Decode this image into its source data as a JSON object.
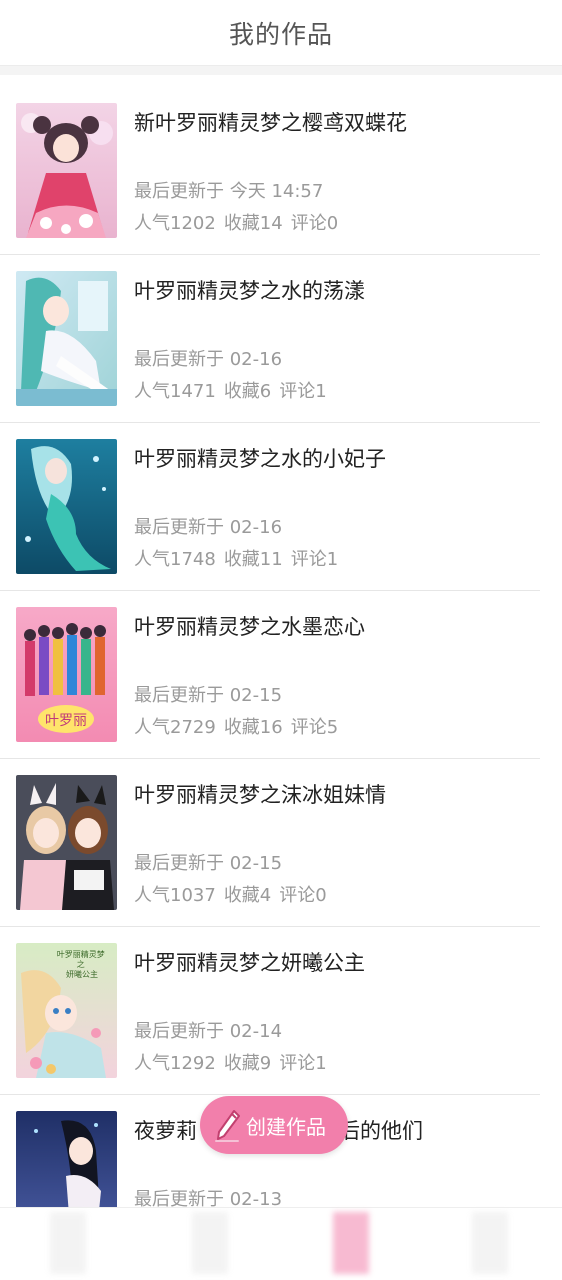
{
  "header": {
    "title": "我的作品"
  },
  "works": [
    {
      "title": "新叶罗丽精灵梦之樱鸢双蝶花",
      "updated": "最后更新于 今天 14:57",
      "popularity": "人气1202",
      "favorites": "收藏14",
      "comments": "评论0"
    },
    {
      "title": "叶罗丽精灵梦之水的荡漾",
      "updated": "最后更新于 02-16",
      "popularity": "人气1471",
      "favorites": "收藏6",
      "comments": "评论1"
    },
    {
      "title": "叶罗丽精灵梦之水的小妃子",
      "updated": "最后更新于 02-16",
      "popularity": "人气1748",
      "favorites": "收藏11",
      "comments": "评论1"
    },
    {
      "title": "叶罗丽精灵梦之水墨恋心",
      "updated": "最后更新于 02-15",
      "popularity": "人气2729",
      "favorites": "收藏16",
      "comments": "评论5"
    },
    {
      "title": "叶罗丽精灵梦之沫冰姐妹情",
      "updated": "最后更新于 02-15",
      "popularity": "人气1037",
      "favorites": "收藏4",
      "comments": "评论0"
    },
    {
      "title": "叶罗丽精灵梦之妍曦公主",
      "updated": "最后更新于 02-14",
      "popularity": "人气1292",
      "favorites": "收藏9",
      "comments": "评论1"
    },
    {
      "title": "夜萝莉",
      "title_tail": "后的他们",
      "updated": "最后更新于 02-13"
    }
  ],
  "fab": {
    "label": "创建作品",
    "icon": "pencil-icon",
    "color": "#f27fab"
  },
  "cover_texts": {
    "item4": "叶罗丽",
    "item6": "叶罗丽精灵梦\n之\n妍曦公主"
  }
}
